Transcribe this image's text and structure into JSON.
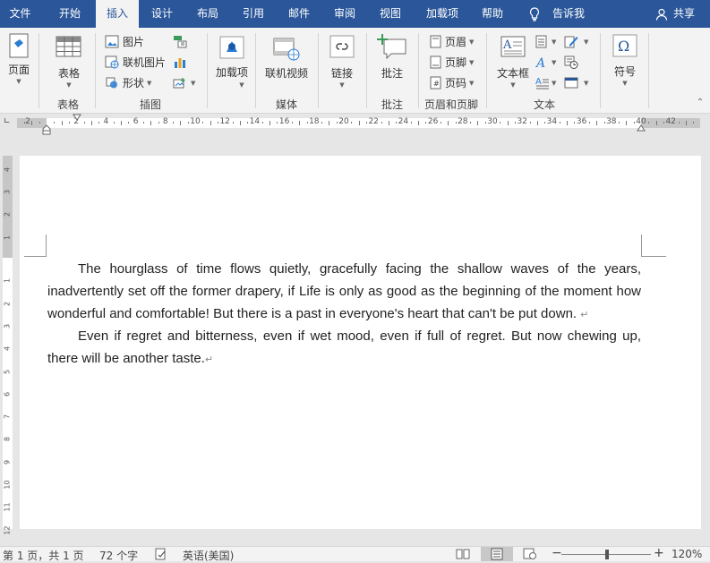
{
  "menu": {
    "tabs": [
      "文件",
      "开始",
      "插入",
      "设计",
      "布局",
      "引用",
      "邮件",
      "审阅",
      "视图",
      "加载项",
      "帮助"
    ],
    "active": "插入",
    "tell_me": "告诉我",
    "share": "共享"
  },
  "ribbon": {
    "page": "页面",
    "table": "表格",
    "group_table": "表格",
    "picture": "图片",
    "online_picture": "联机图片",
    "shapes": "形状",
    "group_illustrations": "插图",
    "addins": "加载项",
    "online_video": "联机视频",
    "group_media": "媒体",
    "link": "链接",
    "comment": "批注",
    "group_comment": "批注",
    "header": "页眉",
    "footer": "页脚",
    "page_number": "页码",
    "group_header_footer": "页眉和页脚",
    "textbox": "文本框",
    "group_text": "文本",
    "symbol": "符号"
  },
  "ruler": {
    "top_labels": [
      "2",
      "2",
      "4",
      "6",
      "8",
      "10",
      "12",
      "14",
      "16",
      "18",
      "20",
      "22",
      "24",
      "26",
      "28",
      "30",
      "32",
      "34",
      "36",
      "38",
      "40",
      "42"
    ],
    "side_labels": [
      "4",
      "3",
      "2",
      "1",
      "1",
      "2",
      "3",
      "4",
      "5",
      "6",
      "7",
      "8",
      "9",
      "10",
      "11",
      "12"
    ]
  },
  "document": {
    "paragraphs": [
      "The hourglass of time flows quietly, gracefully facing the shallow waves of the years, inadvertently set off the former drapery, if Life is only as good as the beginning of the moment how wonderful and comfortable! But there is a past in everyone's heart that can't be put down.",
      "Even if regret and bitterness, even if wet mood, even if full of regret. But now chewing up, there will be another taste."
    ],
    "para_mark": "↵"
  },
  "status": {
    "page": "第 1 页，共 1 页",
    "words": "72 个字",
    "language": "英语(美国)",
    "zoom": "120%"
  },
  "colors": {
    "accent": "#2b579a"
  }
}
